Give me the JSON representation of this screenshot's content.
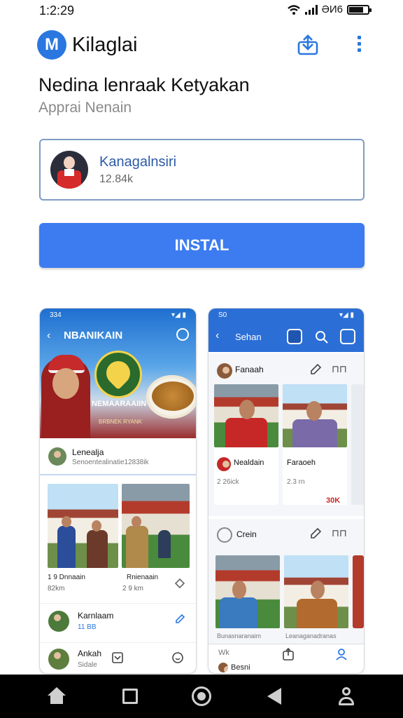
{
  "status_bar": {
    "time": "1:2:29",
    "right_text": "ƏИ6"
  },
  "app_bar": {
    "logo_letter": "M",
    "app_name": "Kilaglai"
  },
  "listing": {
    "title": "Nedina lenraak Ketyakan",
    "subtitle": "Apprai Nenain"
  },
  "developer": {
    "name": "Kanagalnsiri",
    "count": "12.84k"
  },
  "install_label": "INSTAL",
  "screenshot1": {
    "status_time": "334",
    "header_title": "NBANIKAIN",
    "banner_caption": "NEMAARAAIIN",
    "banner_sub": "BRBNEK RYANK",
    "row": {
      "name": "Lenealja",
      "sub": "Senoentealinatie12838ik"
    },
    "photos": [
      {
        "title": "1 9 Dnnaain",
        "meta": "82km"
      },
      {
        "title": "Rnienaain",
        "meta": "2 9 km"
      }
    ],
    "list": [
      {
        "name": "Karnlaam",
        "sub": "11 BB"
      },
      {
        "name": "Ankah",
        "sub": "Sidale"
      }
    ]
  },
  "screenshot2": {
    "status_time": "S0",
    "header_title": "Sehan",
    "section1": {
      "label": "Fanaah",
      "cards": [
        {
          "name": "Nealdain",
          "meta": "2 26ick"
        },
        {
          "name": "Faraoeh",
          "meta": "2.3 rn",
          "badge": "30K"
        }
      ]
    },
    "section2": {
      "label": "Crein",
      "caption1": "Bunasnaranaim",
      "caption2": "Leanaganadranas"
    },
    "bottom": {
      "left": "Wk",
      "avatar_name": "Besni"
    }
  },
  "colors": {
    "accent": "#3c7cf0",
    "header_blue": "#2b6fd6",
    "dev_name": "#2c5aa8"
  },
  "icons": [
    "wifi-icon",
    "signal-icon",
    "battery-icon",
    "share-icon",
    "more-vert-icon",
    "back-arrow-icon",
    "chat-icon",
    "search-icon",
    "edit-icon",
    "home-icon",
    "recents-icon",
    "circle-home-icon",
    "back-icon",
    "profile-icon"
  ]
}
